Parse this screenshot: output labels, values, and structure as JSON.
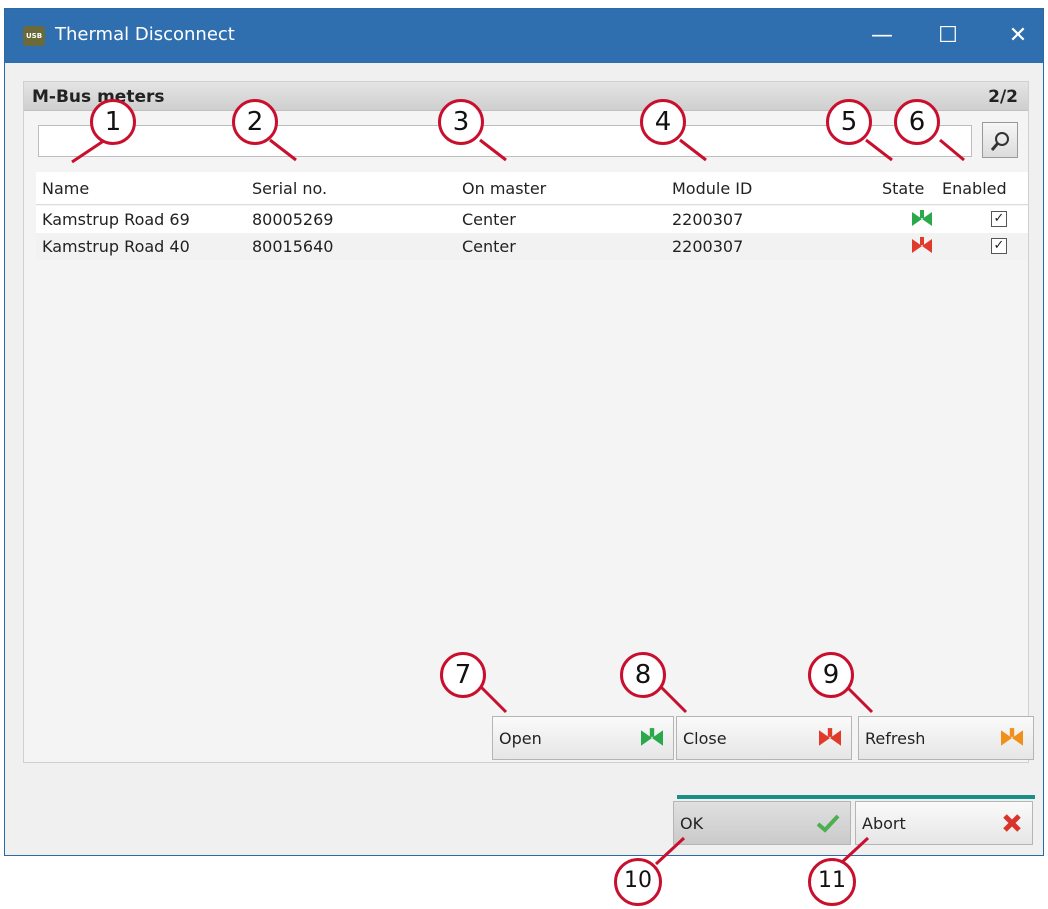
{
  "window": {
    "title": "Thermal Disconnect",
    "app_icon_text": "USB",
    "controls": {
      "minimize": "—",
      "maximize": "☐",
      "close": "✕"
    }
  },
  "panel": {
    "title": "M-Bus meters",
    "count": "2/2",
    "search": {
      "value": "",
      "placeholder": ""
    }
  },
  "table": {
    "columns": [
      "Name",
      "Serial no.",
      "On master",
      "Module ID",
      "State",
      "Enabled"
    ],
    "rows": [
      {
        "name": "Kamstrup Road 69",
        "serial": "80005269",
        "master": "Center",
        "module": "2200307",
        "state": "open",
        "enabled": "✓"
      },
      {
        "name": "Kamstrup Road 40",
        "serial": "80015640",
        "master": "Center",
        "module": "2200307",
        "state": "closed",
        "enabled": "✓"
      }
    ]
  },
  "actions": {
    "open": "Open",
    "close": "Close",
    "refresh": "Refresh"
  },
  "dialog": {
    "ok": "OK",
    "abort": "Abort"
  },
  "callouts": [
    "1",
    "2",
    "3",
    "4",
    "5",
    "6",
    "7",
    "8",
    "9",
    "10",
    "11"
  ],
  "colors": {
    "titlebar": "#2f6fb0",
    "callout": "#c8102e",
    "state_open": "#2aa84a",
    "state_closed": "#e03a2a",
    "refresh": "#f0901a",
    "accent_bar": "#1a8f8a"
  }
}
